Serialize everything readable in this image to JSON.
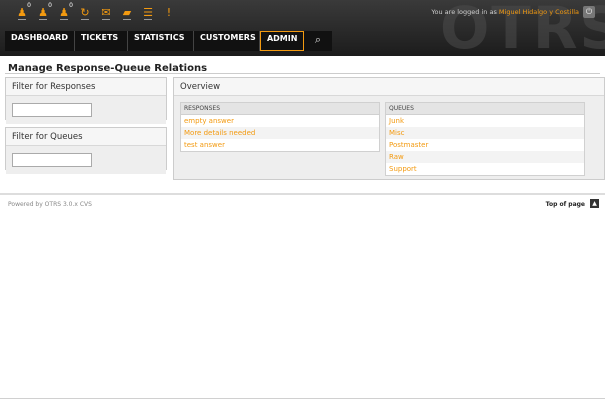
{
  "header": {
    "toolbar": [
      {
        "icon": "locked-tickets-icon",
        "glyph": "♟",
        "count": "0"
      },
      {
        "icon": "watched-tickets-icon",
        "glyph": "♟",
        "count": "0"
      },
      {
        "icon": "responsible-tickets-icon",
        "glyph": "♟",
        "count": "0"
      },
      {
        "icon": "refresh-icon",
        "glyph": "↻",
        "count": ""
      },
      {
        "icon": "new-email-icon",
        "glyph": "✉",
        "count": ""
      },
      {
        "icon": "folder-icon",
        "glyph": "▰",
        "count": ""
      },
      {
        "icon": "list-icon",
        "glyph": "☰",
        "count": ""
      },
      {
        "icon": "alert-icon",
        "glyph": "!",
        "count": ""
      }
    ],
    "watermark": "OTRS",
    "login_prefix": "You are logged in as",
    "user_name": "Miguel Hidalgo y Costilla",
    "nav": [
      "DASHBOARD",
      "TICKETS",
      "STATISTICS",
      "CUSTOMERS",
      "ADMIN"
    ],
    "search_glyph": "⌕",
    "logout_glyph": "⏻"
  },
  "page": {
    "title": "Manage Response-Queue Relations",
    "filter_responses_title": "Filter for Responses",
    "filter_queues_title": "Filter for Queues",
    "overview_title": "Overview",
    "responses_header": "RESPONSES",
    "queues_header": "QUEUES",
    "responses": [
      "empty answer",
      "More details needed",
      "test answer"
    ],
    "queues": [
      "Junk",
      "Misc",
      "Postmaster",
      "Raw",
      "Support"
    ]
  },
  "footer": {
    "powered": "Powered by OTRS 3.0.x CVS",
    "top_of_page": "Top of page",
    "top_glyph": "▲"
  },
  "colors": {
    "accent": "#f39a10",
    "header_bg": "#2a2a2a"
  }
}
